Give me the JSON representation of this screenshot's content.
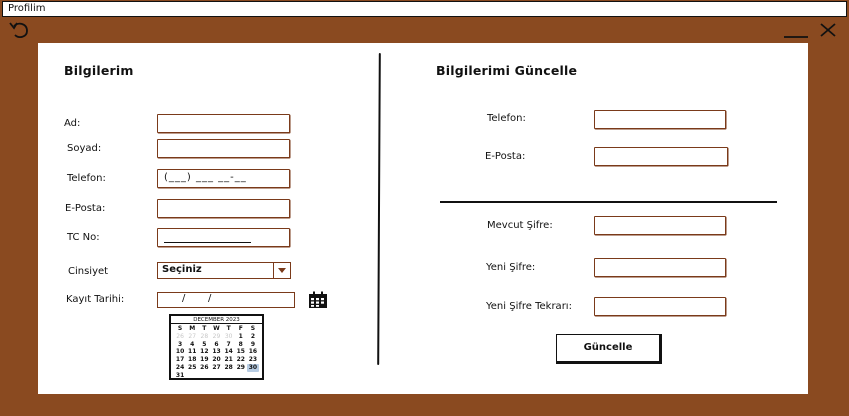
{
  "window": {
    "title": "Profilim"
  },
  "left": {
    "heading": "Bilgilerim",
    "labels": {
      "name": "Ad:",
      "surname": "Soyad:",
      "phone": "Telefon:",
      "email": "E-Posta:",
      "tc": "TC No:",
      "gender": "Cinsiyet",
      "reg_date": "Kayıt Tarihi:"
    },
    "phone_mask": "(___) ___ __-__",
    "gender_select": {
      "value": "Seçiniz"
    },
    "date_mask": {
      "sep1": "/",
      "sep2": "/"
    },
    "calendar": {
      "title": "DECEMBER 2023",
      "weekdays": [
        "S",
        "M",
        "T",
        "W",
        "T",
        "F",
        "S"
      ],
      "cells": [
        {
          "d": "26",
          "dim": true
        },
        {
          "d": "27",
          "dim": true
        },
        {
          "d": "28",
          "dim": true
        },
        {
          "d": "29",
          "dim": true
        },
        {
          "d": "30",
          "dim": true
        },
        {
          "d": "1"
        },
        {
          "d": "2"
        },
        {
          "d": "3"
        },
        {
          "d": "4"
        },
        {
          "d": "5"
        },
        {
          "d": "6"
        },
        {
          "d": "7"
        },
        {
          "d": "8"
        },
        {
          "d": "9"
        },
        {
          "d": "10"
        },
        {
          "d": "11"
        },
        {
          "d": "12"
        },
        {
          "d": "13"
        },
        {
          "d": "14"
        },
        {
          "d": "15"
        },
        {
          "d": "16"
        },
        {
          "d": "17"
        },
        {
          "d": "18"
        },
        {
          "d": "19"
        },
        {
          "d": "20"
        },
        {
          "d": "21"
        },
        {
          "d": "22"
        },
        {
          "d": "23"
        },
        {
          "d": "24"
        },
        {
          "d": "25"
        },
        {
          "d": "26"
        },
        {
          "d": "27"
        },
        {
          "d": "28"
        },
        {
          "d": "29"
        },
        {
          "d": "30",
          "sel": true
        },
        {
          "d": "31"
        }
      ]
    }
  },
  "right": {
    "heading": "Bilgilerimi Güncelle",
    "labels": {
      "phone": "Telefon:",
      "email": "E-Posta:",
      "current_password": "Mevcut Şifre:",
      "new_password": "Yeni Şifre:",
      "new_password_repeat": "Yeni Şifre Tekrarı:"
    },
    "button": "Güncelle"
  },
  "colors": {
    "frame": "#8a4a20",
    "field_border": "#7a3a1a",
    "selected_day": "#b8cde4"
  }
}
